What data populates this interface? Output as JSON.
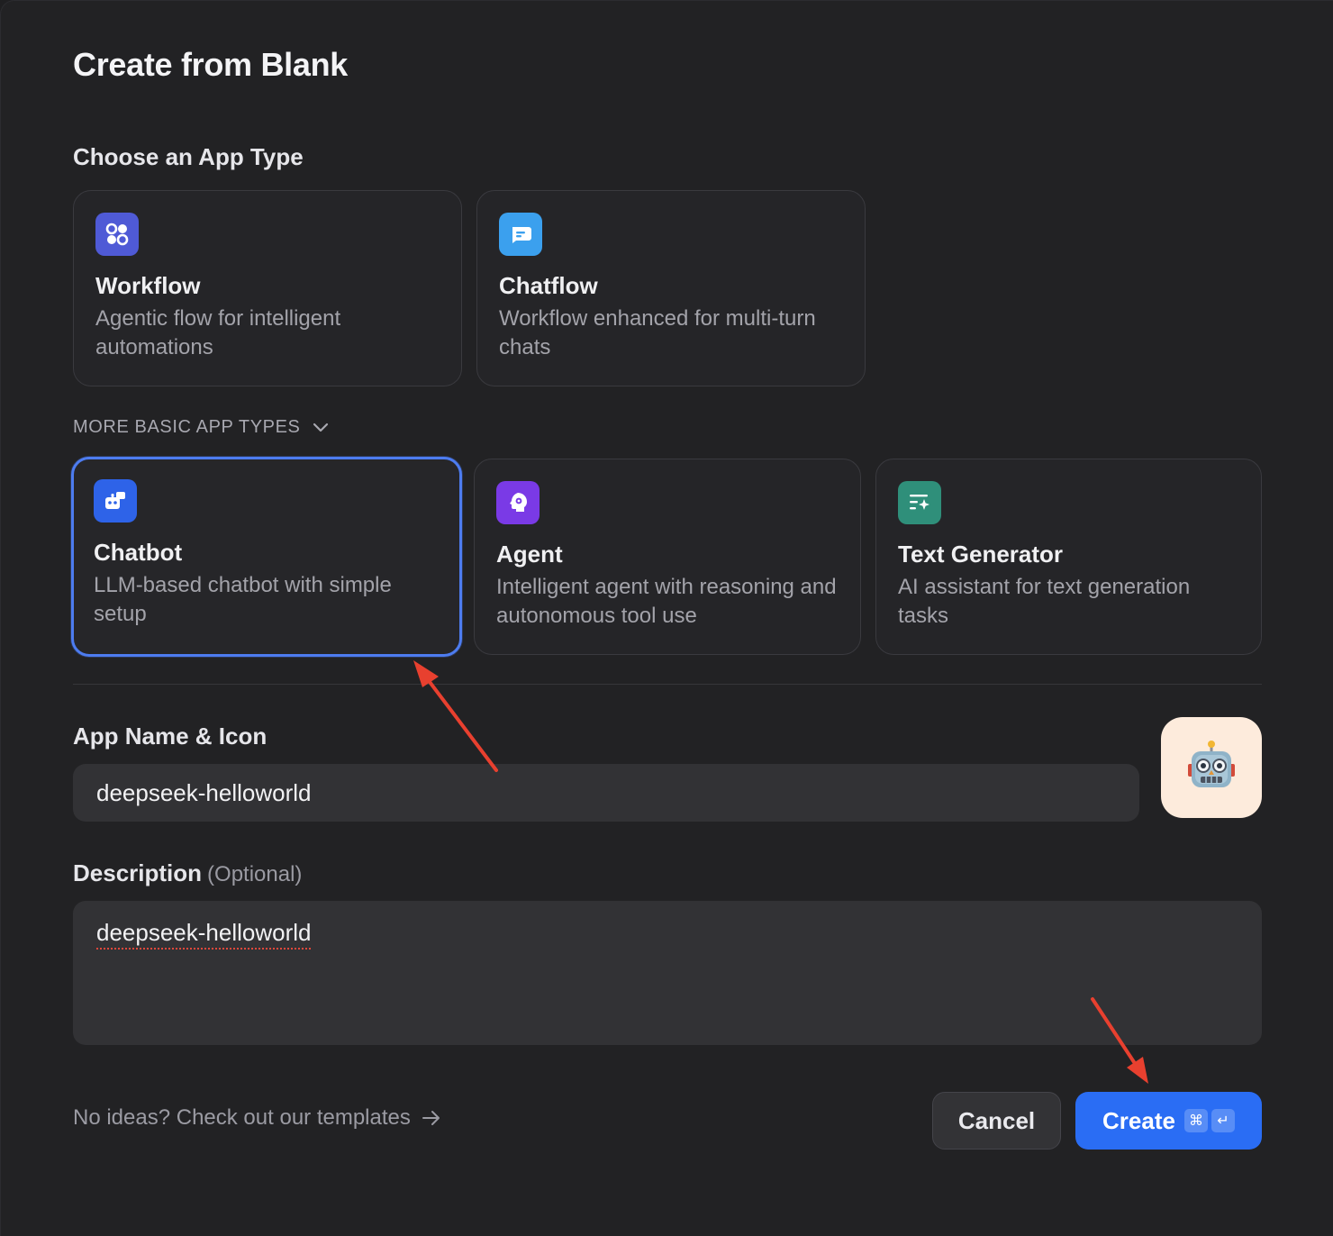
{
  "dialog": {
    "title": "Create from Blank",
    "app_type_label": "Choose an App Type",
    "primary_types": [
      {
        "title": "Workflow",
        "description": "Agentic flow for intelligent automations",
        "icon": "workflow-icon",
        "color": "#4f5ad6"
      },
      {
        "title": "Chatflow",
        "description": "Workflow enhanced for multi-turn chats",
        "icon": "chatflow-icon",
        "color": "#3ba0ee"
      }
    ],
    "more_toggle_label": "MORE BASIC APP TYPES",
    "basic_types": [
      {
        "title": "Chatbot",
        "description": "LLM-based chatbot with simple setup",
        "icon": "chatbot-icon",
        "color": "#2e63e8",
        "selected": true
      },
      {
        "title": "Agent",
        "description": "Intelligent agent with reasoning and autonomous tool use",
        "icon": "agent-icon",
        "color": "#7a3ae6",
        "selected": false
      },
      {
        "title": "Text Generator",
        "description": "AI assistant for text generation tasks",
        "icon": "text-generator-icon",
        "color": "#2f8f7a",
        "selected": false
      }
    ],
    "name_label": "App Name & Icon",
    "name_value": "deepseek-helloworld",
    "app_icon": "robot-emoji-icon",
    "description_label": "Description",
    "description_optional": "(Optional)",
    "description_value": "deepseek-helloworld",
    "templates_link": "No ideas? Check out our templates",
    "cancel_label": "Cancel",
    "create_label": "Create",
    "create_shortcut": [
      "⌘",
      "↵"
    ],
    "accent_color": "#2a6df4",
    "annotation_color": "#e8402f"
  }
}
